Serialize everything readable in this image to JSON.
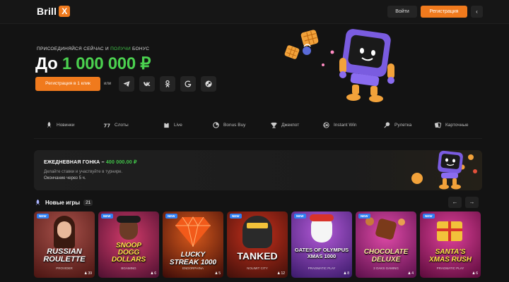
{
  "header": {
    "logo_text": "Brill",
    "logo_mark": "X",
    "login_label": "Войти",
    "register_label": "Регистрация",
    "collapse_icon": "chevron-left-icon"
  },
  "hero": {
    "subtitle_prefix": "ПРИСОЕДИНЯЙСЯ СЕЙЧАС И ",
    "subtitle_highlight": "ПОЛУЧИ",
    "subtitle_suffix": " БОНУС",
    "title_prefix": "До ",
    "title_amount": "1 000 000 ₽",
    "register_button": "Регистрация в 1 клик",
    "or_text": "или",
    "socials": [
      "telegram-icon",
      "vk-icon",
      "odnoklassniki-icon",
      "google-icon",
      "steam-icon"
    ],
    "accent_color": "#f07a1d",
    "green_color": "#4bd14f"
  },
  "categories": [
    {
      "label": "Новинки",
      "icon": "rocket-icon"
    },
    {
      "label": "Слоты",
      "icon": "slots-icon"
    },
    {
      "label": "Live",
      "icon": "live-icon"
    },
    {
      "label": "Bonus Buy",
      "icon": "bonus-buy-icon"
    },
    {
      "label": "Джекпот",
      "icon": "trophy-icon"
    },
    {
      "label": "Instant Win",
      "icon": "instant-win-icon"
    },
    {
      "label": "Рулетка",
      "icon": "roulette-icon"
    },
    {
      "label": "Карточные",
      "icon": "cards-icon"
    }
  ],
  "race": {
    "title_prefix": "ЕЖЕДНЕВНАЯ ГОНКА – ",
    "title_amount": "400 000.00 ₽",
    "description": "Делайте ставки и участвуйте в турнире.",
    "timer": "Окончание через 5 ч."
  },
  "new_games": {
    "title": "Новые игры",
    "count": "21",
    "prev_icon": "arrow-left-icon",
    "next_icon": "arrow-right-icon",
    "games": [
      {
        "badge": "NEW",
        "name": "RUSSIAN\nROULETTE",
        "provider": "PROVIDER",
        "players": "39",
        "bg": "#5a1a16"
      },
      {
        "badge": "NEW",
        "name": "SNOOP\nDOGG\nDOLLARS",
        "provider": "BGAMING",
        "players": "6",
        "bg": "#7c1f3e"
      },
      {
        "badge": "NEW",
        "name": "LUCKY\nSTREAK 1000",
        "provider": "ENDORPHINA",
        "players": "5",
        "bg": "#6b150f"
      },
      {
        "badge": "NEW",
        "name": "TANKED",
        "provider": "NOLIMIT CITY",
        "players": "12",
        "bg": "#7a1a12"
      },
      {
        "badge": "NEW",
        "name": "GATES OF OLYMPUS\nXMAS 1000",
        "provider": "PRAGMATIC PLAY",
        "players": "8",
        "bg": "#6d2a8a"
      },
      {
        "badge": "NEW",
        "name": "CHOCOLATE\nDELUXE",
        "provider": "3 OAKS GAMING",
        "players": "4",
        "bg": "#a7268f"
      },
      {
        "badge": "NEW",
        "name": "SANTA'S\nXMAS RUSH",
        "provider": "PRAGMATIC PLAY",
        "players": "6",
        "bg": "#a0197a"
      }
    ]
  }
}
